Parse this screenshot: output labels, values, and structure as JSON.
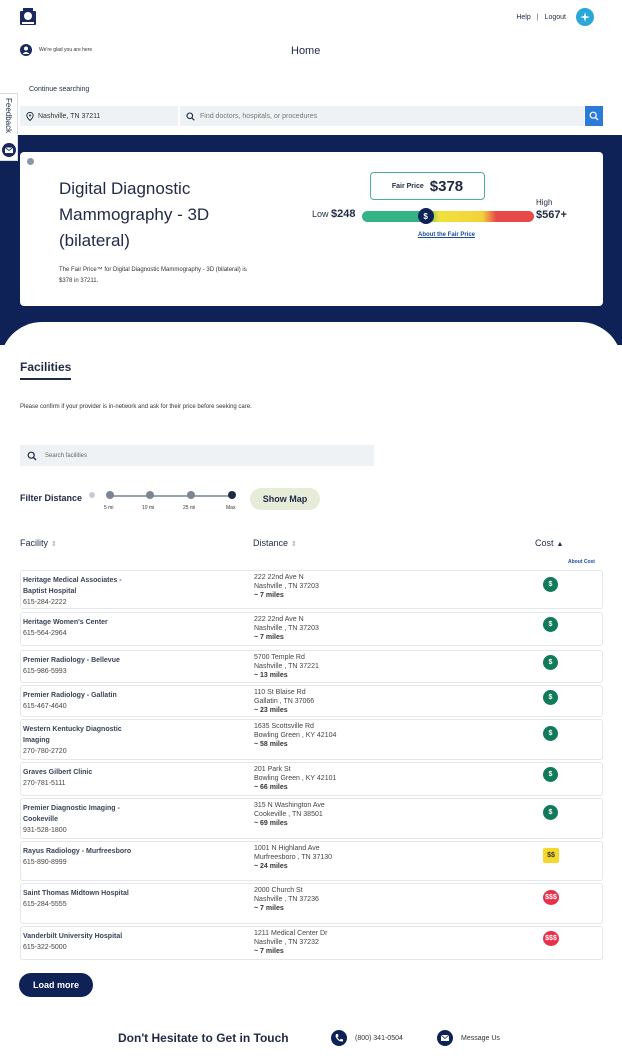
{
  "header": {
    "help": "Help",
    "separator": "|",
    "logout": "Logout",
    "welcome": "We're glad you are here",
    "home": "Home",
    "continue": "Continue searching",
    "location_value": "Nashville, TN 37211",
    "search_placeholder": "Find doctors, hospitals, or procedures"
  },
  "feedback": "Feedback",
  "procedure": {
    "title": "Digital Diagnostic Mammography - 3D (bilateral)",
    "description": "The Fair Price™ for Digital Diagnostic Mammography - 3D (bilateral) is $378 in 37211.",
    "fair_label": "Fair Price",
    "fair_value": "$378",
    "low_label": "Low",
    "low_value": "$248",
    "high_label": "High",
    "high_value": "$567+",
    "marker": "$",
    "fair_position": 0.37,
    "about_fair": "About the Fair Price"
  },
  "facilities": {
    "title": "Facilities",
    "note": "Please confirm if your provider is in-network and ask for their price before seeking care.",
    "search_placeholder": "Search facilities",
    "filter_label": "Filter Distance",
    "distance_options": [
      "5 mi",
      "10 mi",
      "25 mi",
      "Max"
    ],
    "selected_distance": "Max",
    "show_map": "Show Map",
    "col_facility": "Facility",
    "col_distance": "Distance",
    "col_cost": "Cost",
    "about_cost": "About Cost",
    "load_more": "Load more",
    "rows": [
      {
        "name": "Heritage Medical Associates - Baptist Hospital",
        "phone": "615-284-2222",
        "street": "222 22nd Ave N",
        "city": "Nashville , TN 37203",
        "miles": "~ 7 miles",
        "cost": "$",
        "tier": 1
      },
      {
        "name": "Heritage Women's Center",
        "phone": "615-564-2964",
        "street": "222 22nd Ave N",
        "city": "Nashville , TN 37203",
        "miles": "~ 7 miles",
        "cost": "$",
        "tier": 1
      },
      {
        "name": "Premier Radiology - Bellevue",
        "phone": "615-986-5993",
        "street": "5700 Temple Rd",
        "city": "Nashville , TN 37221",
        "miles": "~ 13 miles",
        "cost": "$",
        "tier": 1
      },
      {
        "name": "Premier Radiology - Gallatin",
        "phone": "615-467-4640",
        "street": "110 St Blaise Rd",
        "city": "Gallatin , TN 37066",
        "miles": "~ 23 miles",
        "cost": "$",
        "tier": 1
      },
      {
        "name": "Western Kentucky Diagnostic Imaging",
        "phone": "270-780-2720",
        "street": "1635 Scottsville Rd",
        "city": "Bowling Green , KY 42104",
        "miles": "~ 58 miles",
        "cost": "$",
        "tier": 1
      },
      {
        "name": "Graves Gilbert Clinic",
        "phone": "270-781-5111",
        "street": "201 Park St",
        "city": "Bowling Green , KY 42101",
        "miles": "~ 66 miles",
        "cost": "$",
        "tier": 1
      },
      {
        "name": "Premier Diagnostic Imaging - Cookeville",
        "phone": "931-528-1800",
        "street": "315 N Washington Ave",
        "city": "Cookeville , TN 38501",
        "miles": "~ 69 miles",
        "cost": "$",
        "tier": 1
      },
      {
        "name": "Rayus Radiology - Murfreesboro",
        "phone": "615-890-8999",
        "street": "1001 N Highland Ave",
        "city": "Murfreesboro , TN 37130",
        "miles": "~ 24 miles",
        "cost": "$$",
        "tier": 2
      },
      {
        "name": "Saint Thomas Midtown Hospital",
        "phone": "615-284-5555",
        "street": "2000 Church St",
        "city": "Nashville , TN 37236",
        "miles": "~ 7 miles",
        "cost": "$$$",
        "tier": 3
      },
      {
        "name": "Vanderbilt University Hospital",
        "phone": "615-322-5000",
        "street": "1211 Medical Center Dr",
        "city": "Nashville , TN 37232",
        "miles": "~ 7 miles",
        "cost": "$$$",
        "tier": 3
      }
    ]
  },
  "contact": {
    "title": "Don't Hesitate to Get in Touch",
    "phone": "(800) 341-0504",
    "message": "Message Us"
  },
  "colors": {
    "navy": "#0f2257",
    "accent_blue": "#2c7bd8",
    "cost_low": "#127a5b",
    "cost_mid": "#f5d82a",
    "cost_high": "#e8304a"
  }
}
